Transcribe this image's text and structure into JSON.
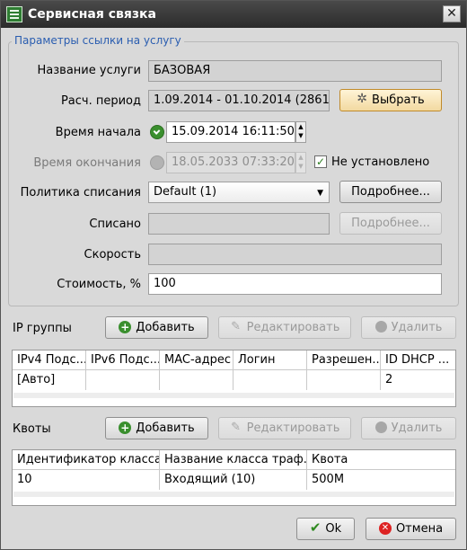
{
  "window": {
    "title": "Сервисная связка",
    "close_glyph": "✕"
  },
  "params": {
    "group_title": "Параметры ссылки на услугу",
    "service_name": {
      "label": "Название услуги",
      "value": "БАЗОВАЯ"
    },
    "period": {
      "label": "Расч. период",
      "value": "1.09.2014 - 01.10.2014 (2861)",
      "button": "Выбрать"
    },
    "start_time": {
      "label": "Время начала",
      "value": "15.09.2014 16:11:50"
    },
    "end_time": {
      "label": "Время окончания",
      "value": "18.05.2033 07:33:20",
      "checkbox_label": "Не установлено",
      "checked": true
    },
    "policy": {
      "label": "Политика списания",
      "value": "Default (1)",
      "button": "Подробнее..."
    },
    "charged": {
      "label": "Списано",
      "value": "",
      "button": "Подробнее..."
    },
    "speed": {
      "label": "Скорость",
      "value": ""
    },
    "cost": {
      "label": "Стоимость, %",
      "value": "100"
    }
  },
  "ip_groups": {
    "label": "IP группы",
    "add": "Добавить",
    "edit": "Редактировать",
    "delete": "Удалить",
    "columns": [
      "IPv4 Подс...",
      "IPv6 Подс...",
      "MAC-адрес",
      "Логин",
      "Разрешен...",
      "ID DHCP ..."
    ],
    "rows": [
      [
        "[Авто]",
        "",
        "",
        "",
        "",
        "2"
      ]
    ]
  },
  "quotas": {
    "label": "Квоты",
    "add": "Добавить",
    "edit": "Редактировать",
    "delete": "Удалить",
    "columns": [
      "Идентификатор класса",
      "Название класса траф...",
      "Квота"
    ],
    "rows": [
      [
        "10",
        "Входящий (10)",
        "500M"
      ]
    ]
  },
  "footer": {
    "ok": "Ok",
    "cancel": "Отмена"
  },
  "icons": {
    "app": "list-window-icon",
    "select": "gear-icon",
    "add": "green-plus-icon",
    "edit": "pencil-icon",
    "delete": "gray-circle-icon",
    "ok": "green-check-icon",
    "cancel": "red-cancel-icon"
  },
  "colors": {
    "title_bar": "#333333",
    "group_title": "#2a5db0",
    "highlight_button": "#f2d9a0"
  }
}
